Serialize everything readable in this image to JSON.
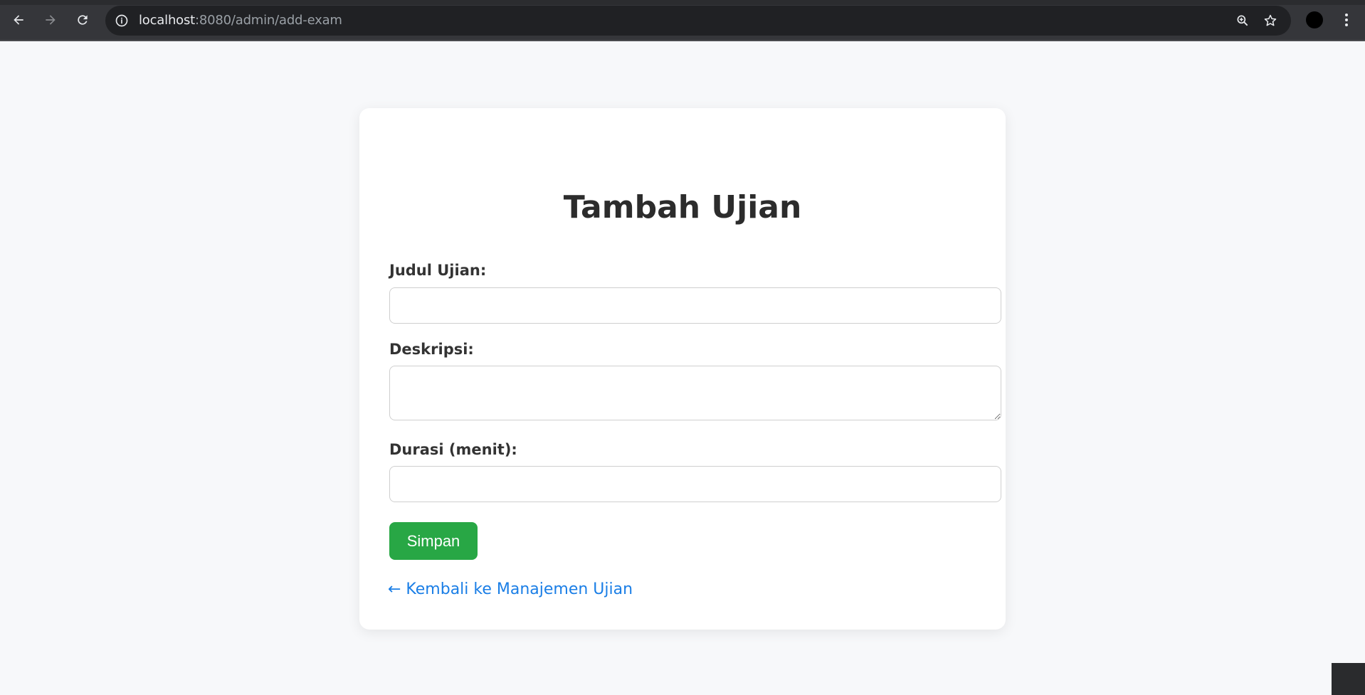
{
  "browser": {
    "url_host": "localhost",
    "url_path": ":8080/admin/add-exam",
    "icons": [
      "back-arrow-icon",
      "forward-arrow-icon",
      "reload-icon",
      "info-icon",
      "zoom-icon",
      "star-icon",
      "profile-avatar",
      "more-vert-icon"
    ]
  },
  "form": {
    "title": "Tambah Ujian",
    "fields": [
      {
        "label": "Judul Ujian:",
        "value": "",
        "type": "text"
      },
      {
        "label": "Deskripsi:",
        "value": "",
        "type": "textarea"
      },
      {
        "label": "Durasi (menit):",
        "value": "",
        "type": "number"
      }
    ],
    "save_label": "Simpan",
    "back_link": "← Kembali ke Manajemen Ujian"
  },
  "colors": {
    "page_bg": "#f7f8fa",
    "card_bg": "#ffffff",
    "save_button": "#28a745",
    "link": "#1a7ee6",
    "heading": "#2c2c2c"
  }
}
